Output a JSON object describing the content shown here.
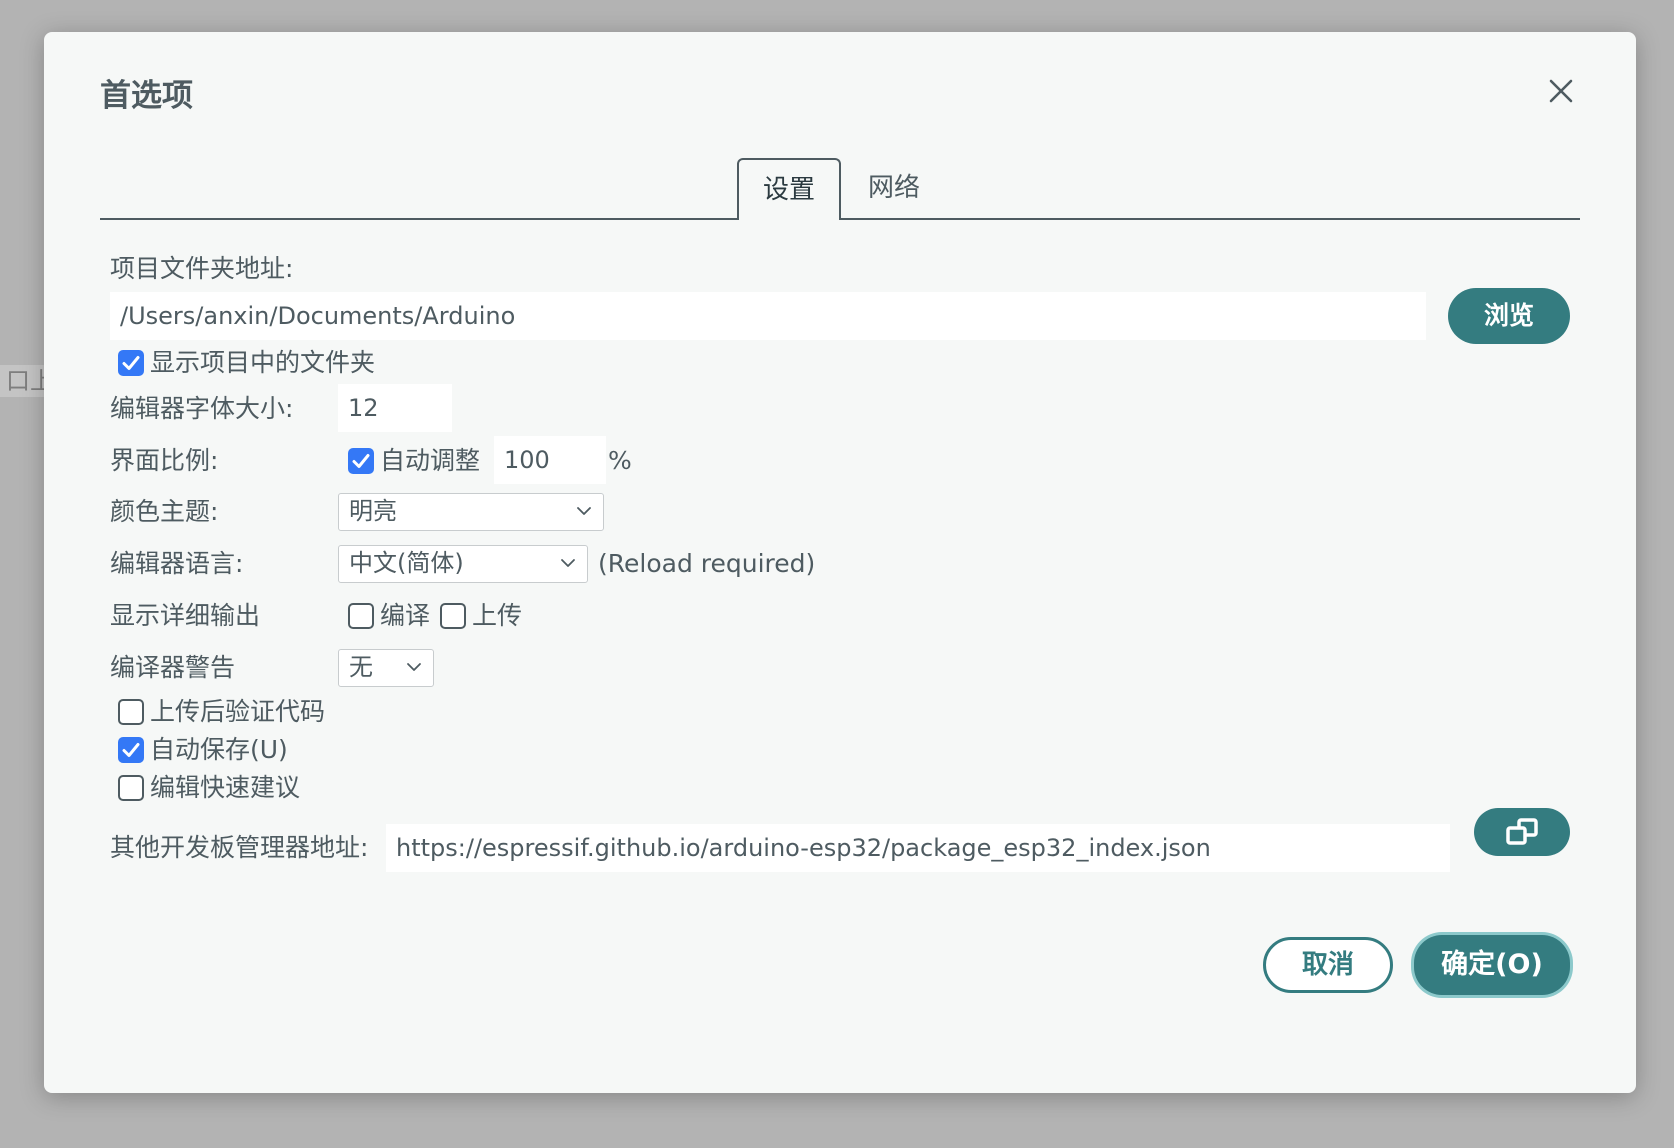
{
  "background": {
    "fragment_text": "口上"
  },
  "dialog": {
    "title": "首选项",
    "tabs": [
      {
        "label": "设置",
        "active": true
      },
      {
        "label": "网络",
        "active": false
      }
    ],
    "sketchbook": {
      "label": "项目文件夹地址:",
      "value": "/Users/anxin/Documents/Arduino",
      "browse_label": "浏览",
      "show_files_label": "显示项目中的文件夹",
      "show_files_checked": true
    },
    "font_size": {
      "label": "编辑器字体大小:",
      "value": "12"
    },
    "scale": {
      "label": "界面比例:",
      "auto_label": "自动调整",
      "auto_checked": true,
      "value": "100",
      "unit": "%"
    },
    "theme": {
      "label": "颜色主题:",
      "selected": "明亮"
    },
    "language": {
      "label": "编辑器语言:",
      "selected": "中文(简体)",
      "note": "(Reload required)"
    },
    "verbose": {
      "label": "显示详细输出",
      "compile_label": "编译",
      "compile_checked": false,
      "upload_label": "上传",
      "upload_checked": false
    },
    "warnings": {
      "label": "编译器警告",
      "selected": "无"
    },
    "verify_after_upload": {
      "label": "上传后验证代码",
      "checked": false
    },
    "auto_save": {
      "label": "自动保存(U)",
      "checked": true
    },
    "quick_suggestions": {
      "label": "编辑快速建议",
      "checked": false
    },
    "board_manager": {
      "label": "其他开发板管理器地址:",
      "value": "https://espressif.github.io/arduino-esp32/package_esp32_index.json",
      "open_icon": "window-restore-icon"
    },
    "footer": {
      "cancel_label": "取消",
      "ok_label": "确定(O)"
    }
  },
  "colors": {
    "accent": "#347c80",
    "checkbox_checked": "#3478f6",
    "text": "#4e5b61",
    "dialog_bg": "#f6f8f7"
  }
}
